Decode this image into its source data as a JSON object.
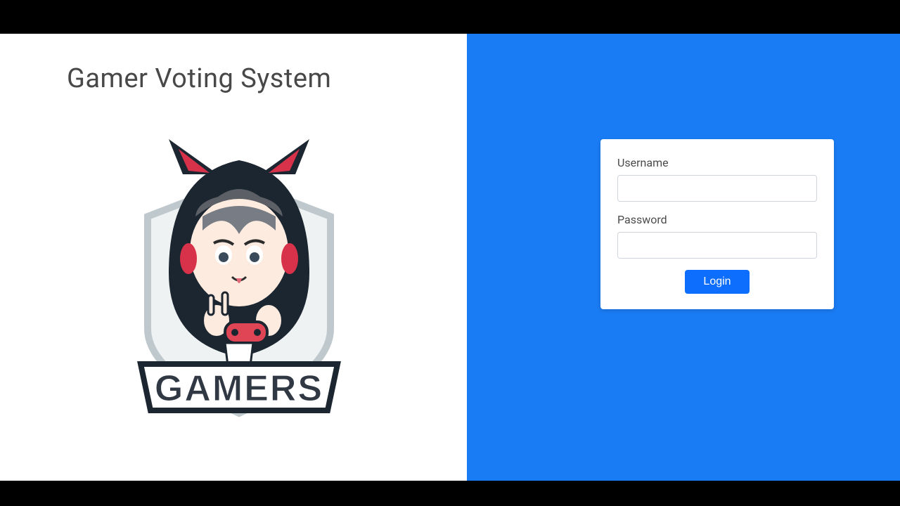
{
  "header": {
    "title": "Gamer Voting System"
  },
  "logo": {
    "banner_text": "GAMERS"
  },
  "login": {
    "username_label": "Username",
    "username_value": "",
    "password_label": "Password",
    "password_value": "",
    "submit_label": "Login"
  },
  "colors": {
    "panel_blue": "#1a7cf4",
    "button_blue": "#0d6efd",
    "title_grey": "#484848",
    "letterbox": "#000000"
  }
}
